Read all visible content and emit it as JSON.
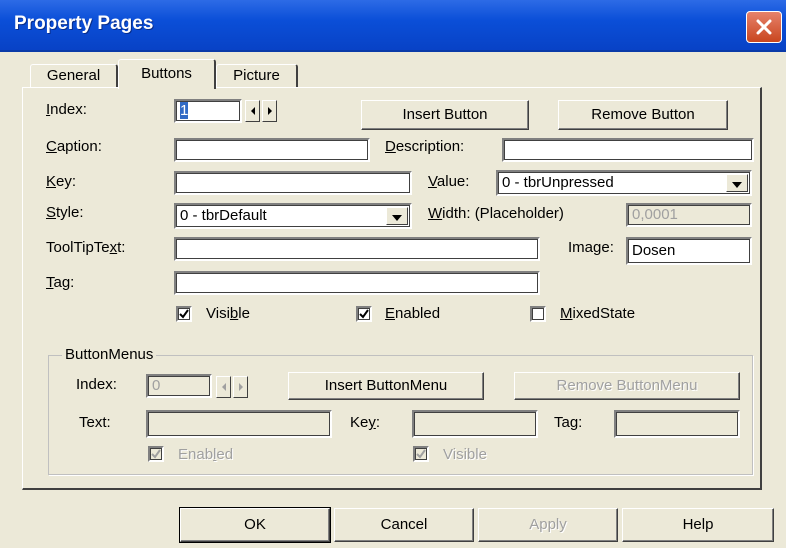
{
  "window": {
    "title": "Property Pages"
  },
  "tabs": [
    {
      "label": "General",
      "active": false
    },
    {
      "label": "Buttons",
      "active": true
    },
    {
      "label": "Picture",
      "active": false
    }
  ],
  "buttons_tab": {
    "index_label": "Index:",
    "index_value": "1",
    "insert_button": "Insert Button",
    "remove_button": "Remove Button",
    "caption_label": "Caption:",
    "caption_value": "",
    "description_label": "Description:",
    "description_value": "",
    "key_label": "Key:",
    "key_value": "",
    "value_label": "Value:",
    "value_selected": "0 - tbrUnpressed",
    "style_label": "Style:",
    "style_selected": "0 - tbrDefault",
    "width_label": "Width: (Placeholder)",
    "width_value": "0,0001",
    "tooltip_label": "ToolTipText:",
    "tooltip_value": "",
    "image_label": "Image:",
    "image_value": "Dosen",
    "tag_label": "Tag:",
    "tag_value": "",
    "visible_label": "Visible",
    "visible_checked": true,
    "enabled_label": "Enabled",
    "enabled_checked": true,
    "mixedstate_label": "MixedState",
    "mixedstate_checked": false
  },
  "button_menus": {
    "group_label": "ButtonMenus",
    "index_label": "Index:",
    "index_value": "0",
    "insert_button": "Insert ButtonMenu",
    "remove_button": "Remove ButtonMenu",
    "text_label": "Text:",
    "key_label": "Key:",
    "tag_label": "Tag:",
    "enabled_label": "Enabled",
    "visible_label": "Visible"
  },
  "footer": {
    "ok": "OK",
    "cancel": "Cancel",
    "apply": "Apply",
    "help": "Help"
  },
  "colors": {
    "titlebar": "#0b4fd8",
    "dialog_bg": "#ece9d8",
    "close_button": "#c9461f"
  }
}
